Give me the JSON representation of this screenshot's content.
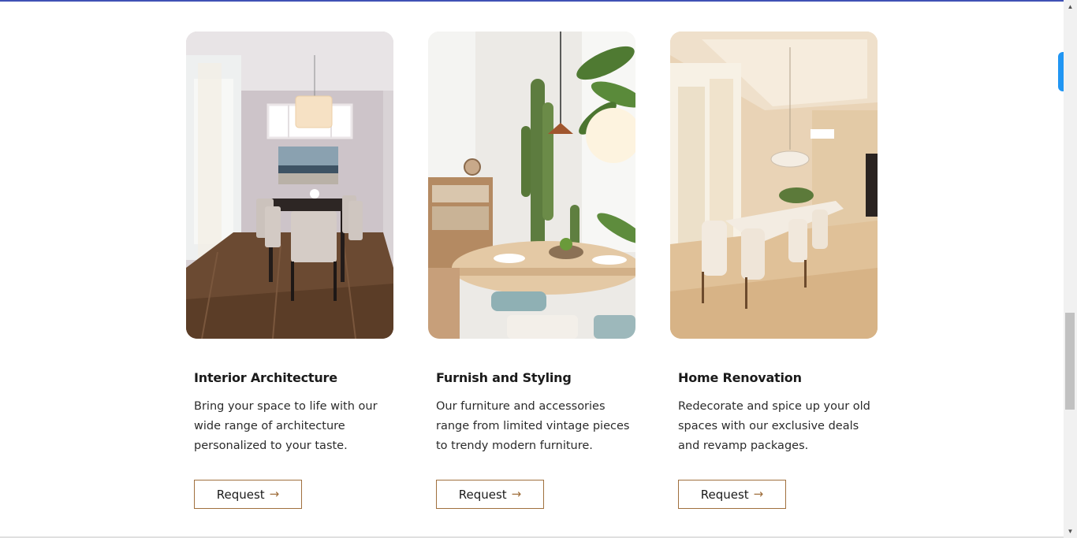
{
  "cards": [
    {
      "title": "Interior Architecture",
      "description": "Bring your space to life with our wide range of architecture personalized to your taste.",
      "button_label": "Request",
      "image_icon": "dining-room-photo"
    },
    {
      "title": "Furnish and Styling",
      "description": "Our furniture and accessories range from limited vintage pieces to trendy modern furniture.",
      "button_label": "Request",
      "image_icon": "round-table-cactus-photo"
    },
    {
      "title": "Home Renovation",
      "description": "Redecorate and spice up your old spaces with our exclusive deals and revamp packages.",
      "button_label": "Request",
      "image_icon": "long-dining-table-photo"
    }
  ],
  "colors": {
    "accent_brown": "#a0703e",
    "top_bar": "#3f51b5",
    "side_tab": "#2196f3"
  },
  "arrow_glyph": "→"
}
